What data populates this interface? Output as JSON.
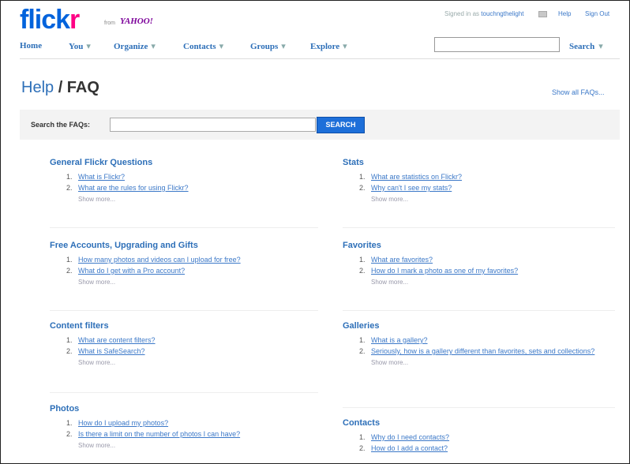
{
  "header": {
    "logo_flick": "flick",
    "logo_r": "r",
    "from_text": "from",
    "yahoo_text": "YAHOO!",
    "signed_in_prefix": "Signed in as",
    "signed_in_user": "touchngthelight",
    "help_label": "Help",
    "signout_label": "Sign Out"
  },
  "nav": {
    "items": [
      {
        "label": "Home",
        "caret": ""
      },
      {
        "label": "You",
        "caret": "▾"
      },
      {
        "label": "Organize",
        "caret": "▾"
      },
      {
        "label": "Contacts",
        "caret": "▾"
      },
      {
        "label": "Groups",
        "caret": "▾"
      },
      {
        "label": "Explore",
        "caret": "▾"
      }
    ],
    "search_value": "",
    "search_label": "Search",
    "search_caret": "▾"
  },
  "page": {
    "title_help": "Help",
    "title_rest": " / FAQ",
    "show_all": "Show all FAQs..."
  },
  "faq_search": {
    "label": "Search the FAQs:",
    "value": "",
    "button": "SEARCH"
  },
  "sections": [
    {
      "title": "General Flickr Questions",
      "items": [
        "What is Flickr?",
        "What are the rules for using Flickr?"
      ],
      "more": "Show more..."
    },
    {
      "title": "Stats",
      "items": [
        "What are statistics on Flickr?",
        "Why can't I see my stats?"
      ],
      "more": "Show more..."
    },
    {
      "title": "Free Accounts, Upgrading and Gifts",
      "items": [
        "How many photos and videos can I upload for free?",
        "What do I get with a Pro account?"
      ],
      "more": "Show more..."
    },
    {
      "title": "Favorites",
      "items": [
        "What are favorites?",
        "How do I mark a photo as one of my favorites?"
      ],
      "more": "Show more..."
    },
    {
      "title": "Content filters",
      "items": [
        "What are content filters?",
        "What is SafeSearch?"
      ],
      "more": "Show more..."
    },
    {
      "title": "Galleries",
      "items": [
        "What is a gallery?",
        "Seriously, how is a gallery different than favorites, sets and collections?"
      ],
      "more": "Show more..."
    },
    {
      "title": "Photos",
      "items": [
        "How do I upload my photos?",
        "Is there a limit on the number of photos I can have?"
      ],
      "more": "Show more..."
    },
    {
      "title": "Contacts",
      "items": [
        "Why do I need contacts?",
        "How do I add a contact?"
      ],
      "more": ""
    }
  ],
  "colors": {
    "flickr_blue": "#0063dc",
    "flickr_pink": "#ff0084",
    "link_blue": "#3b78c8",
    "button_blue": "#1d6fd9"
  }
}
